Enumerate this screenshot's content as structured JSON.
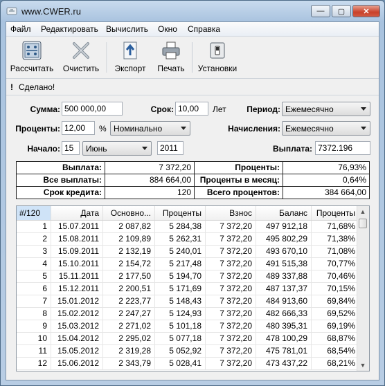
{
  "window": {
    "title": "www.CWER.ru"
  },
  "menu": [
    "Файл",
    "Редактировать",
    "Вычислить",
    "Окно",
    "Справка"
  ],
  "toolbar": {
    "calculate": "Рассчитать",
    "clear": "Очистить",
    "export": "Экспорт",
    "print": "Печать",
    "settings": "Установки"
  },
  "status": {
    "icon": "!",
    "text": "Сделано!"
  },
  "form": {
    "sum_label": "Сумма:",
    "sum_value": "500 000,00",
    "term_label": "Срок:",
    "term_value": "10,00",
    "term_unit": "Лет",
    "period_label": "Период:",
    "period_value": "Ежемесячно",
    "rate_label": "Проценты:",
    "rate_value": "12,00",
    "rate_unit": "%",
    "rate_type": "Номинально",
    "accrual_label": "Начисления:",
    "accrual_value": "Ежемесячно",
    "start_label": "Начало:",
    "start_day": "15",
    "start_month": "Июнь",
    "start_year": "2011",
    "payment_label": "Выплата:",
    "payment_value": "7372.196"
  },
  "summary": {
    "payment_label": "Выплата:",
    "payment_value": "7 372,20",
    "interest_label": "Проценты:",
    "interest_value": "76,93%",
    "total_label": "Все выплаты:",
    "total_value": "884 664,00",
    "monthly_label": "Проценты в месяц:",
    "monthly_value": "0,64%",
    "term_label": "Срок кредита:",
    "term_value": "120",
    "total_interest_label": "Всего процентов:",
    "total_interest_value": "384 664,00"
  },
  "table": {
    "headers": [
      "#/120",
      "Дата",
      "Основно...",
      "Проценты",
      "Взнос",
      "Баланс",
      "Проценты"
    ],
    "rows": [
      [
        "1",
        "15.07.2011",
        "2 087,82",
        "5 284,38",
        "7 372,20",
        "497 912,18",
        "71,68%"
      ],
      [
        "2",
        "15.08.2011",
        "2 109,89",
        "5 262,31",
        "7 372,20",
        "495 802,29",
        "71,38%"
      ],
      [
        "3",
        "15.09.2011",
        "2 132,19",
        "5 240,01",
        "7 372,20",
        "493 670,10",
        "71,08%"
      ],
      [
        "4",
        "15.10.2011",
        "2 154,72",
        "5 217,48",
        "7 372,20",
        "491 515,38",
        "70,77%"
      ],
      [
        "5",
        "15.11.2011",
        "2 177,50",
        "5 194,70",
        "7 372,20",
        "489 337,88",
        "70,46%"
      ],
      [
        "6",
        "15.12.2011",
        "2 200,51",
        "5 171,69",
        "7 372,20",
        "487 137,37",
        "70,15%"
      ],
      [
        "7",
        "15.01.2012",
        "2 223,77",
        "5 148,43",
        "7 372,20",
        "484 913,60",
        "69,84%"
      ],
      [
        "8",
        "15.02.2012",
        "2 247,27",
        "5 124,93",
        "7 372,20",
        "482 666,33",
        "69,52%"
      ],
      [
        "9",
        "15.03.2012",
        "2 271,02",
        "5 101,18",
        "7 372,20",
        "480 395,31",
        "69,19%"
      ],
      [
        "10",
        "15.04.2012",
        "2 295,02",
        "5 077,18",
        "7 372,20",
        "478 100,29",
        "68,87%"
      ],
      [
        "11",
        "15.05.2012",
        "2 319,28",
        "5 052,92",
        "7 372,20",
        "475 781,01",
        "68,54%"
      ],
      [
        "12",
        "15.06.2012",
        "2 343,79",
        "5 028,41",
        "7 372,20",
        "473 437,22",
        "68,21%"
      ]
    ]
  }
}
